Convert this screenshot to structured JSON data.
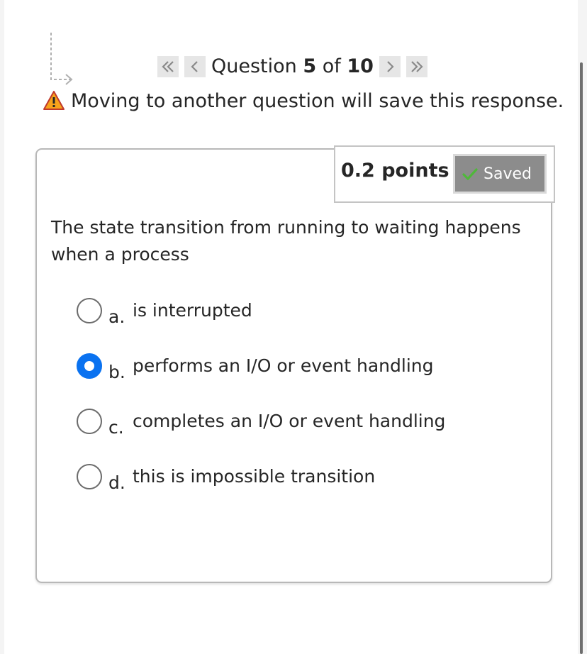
{
  "navigation": {
    "question_word": "Question",
    "current_number": "5",
    "of_word": "of",
    "total_number": "10"
  },
  "warning": {
    "text": "Moving to another question will save this response."
  },
  "points": {
    "label": "0.2 points",
    "saved_label": "Saved"
  },
  "question": {
    "text": "The state transition from running to waiting happens when a process",
    "selected": "b",
    "options": [
      {
        "letter": "a.",
        "text": "is interrupted"
      },
      {
        "letter": "b.",
        "text": "performs an I/O or event handling"
      },
      {
        "letter": "c.",
        "text": "completes an I/O or event handling"
      },
      {
        "letter": "d.",
        "text": "this is impossible transition"
      }
    ]
  },
  "colors": {
    "accent": "#0a72f0",
    "saved_bg": "#8c8c8c",
    "warning_fill": "#f7a21b",
    "check_green": "#4fb83a"
  },
  "icons": {
    "nav_hint": "arrow-down-right-icon",
    "first": "double-chevron-left-icon",
    "prev": "chevron-left-icon",
    "next": "chevron-right-icon",
    "last": "double-chevron-right-icon",
    "warning": "warning-triangle-icon",
    "saved": "check-icon"
  }
}
